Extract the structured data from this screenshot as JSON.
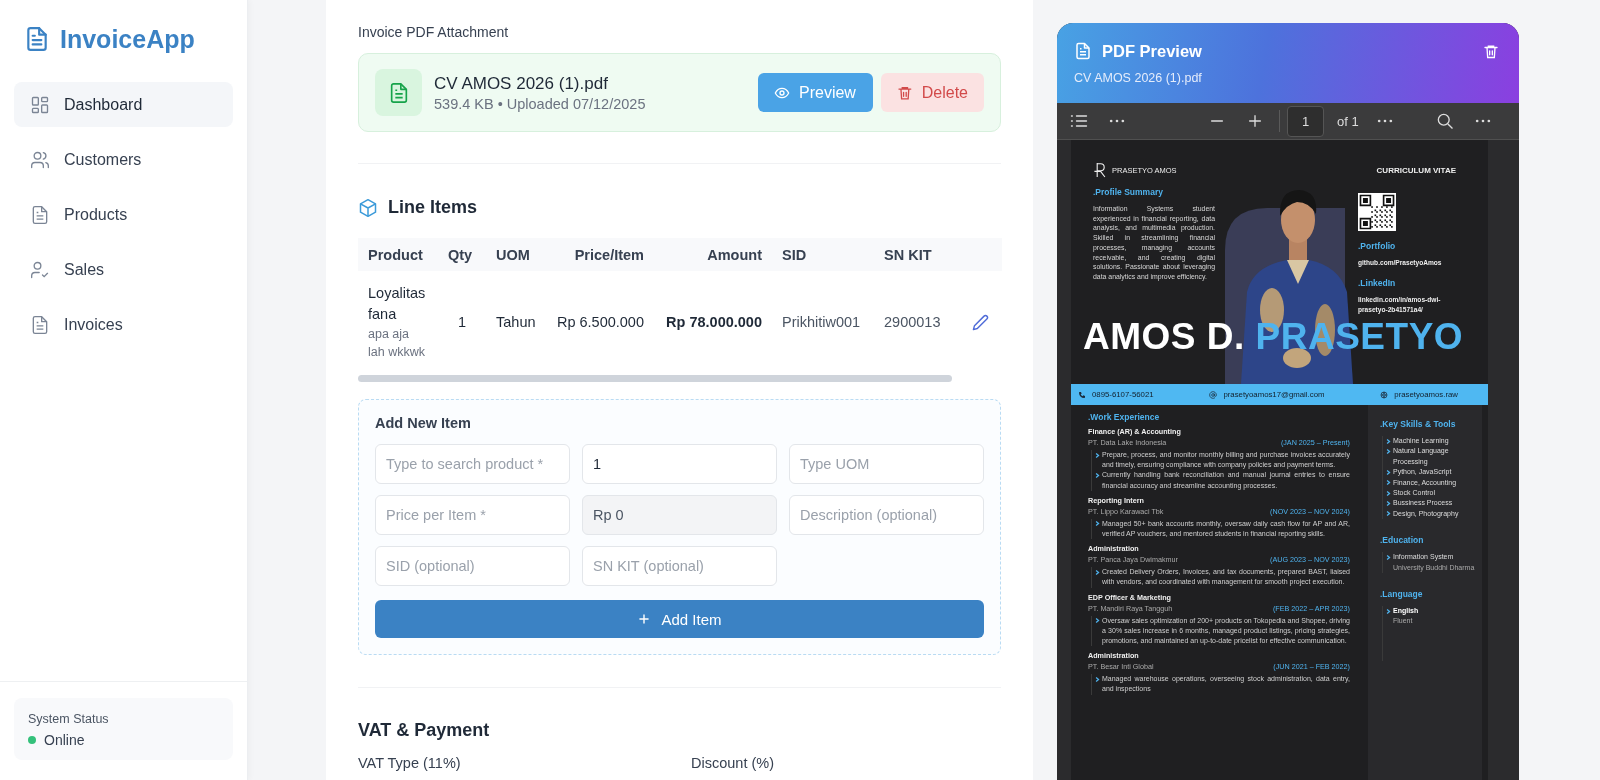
{
  "sidebar": {
    "logo": "InvoiceApp",
    "items": [
      {
        "label": "Dashboard",
        "selected": true
      },
      {
        "label": "Customers",
        "selected": false
      },
      {
        "label": "Products",
        "selected": false
      },
      {
        "label": "Sales",
        "selected": false
      },
      {
        "label": "Invoices",
        "selected": false
      }
    ],
    "system_status": {
      "label": "System Status",
      "status": "Online",
      "online": true
    }
  },
  "attachment": {
    "label": "Invoice PDF Attachment",
    "file_name": "CV AMOS 2026 (1).pdf",
    "meta": "539.4 KB • Uploaded 07/12/2025",
    "buttons": [
      {
        "label": "Preview",
        "kind": "preview"
      },
      {
        "label": "Delete",
        "kind": "delete"
      }
    ]
  },
  "line_items": {
    "title": "Line Items",
    "columns": [
      "Product",
      "Qty",
      "UOM",
      "Price/Item",
      "Amount",
      "SID",
      "SN KIT"
    ],
    "rows": [
      {
        "product": "Loyalitas fana",
        "description": "apa aja lah wkkwk",
        "qty": "1",
        "uom": "Tahun",
        "price": "Rp 6.500.000",
        "amount": "Rp 78.000.000",
        "sid": "Prikhitiw001",
        "sn_kit": "2900013"
      }
    ]
  },
  "add_item": {
    "title": "Add New Item",
    "fields": [
      {
        "placeholder": "Type to search product *",
        "disabled": false
      },
      {
        "value": "1",
        "disabled": false
      },
      {
        "placeholder": "Type UOM",
        "disabled": false
      },
      {
        "placeholder": "Price per Item *",
        "disabled": false
      },
      {
        "value": "Rp 0",
        "disabled": true
      },
      {
        "placeholder": "Description (optional)",
        "disabled": false
      },
      {
        "placeholder": "SID (optional)",
        "disabled": false
      },
      {
        "placeholder": "SN KIT (optional)",
        "disabled": false
      }
    ],
    "button": "Add Item"
  },
  "vat_payment": {
    "title": "VAT & Payment",
    "labels": [
      "VAT Type (11%)",
      "Discount (%)"
    ]
  },
  "pdf_preview": {
    "title": "PDF Preview",
    "file_name": "CV AMOS 2026 (1).pdf",
    "toolbar": {
      "page": "1",
      "page_count": "of 1"
    },
    "document": {
      "brand": "PRASETYO AMOS",
      "heading": "CURRICULUM VITAE",
      "profile": {
        "title": ".Profile Summary",
        "text": "Information Systems student experienced in financial reporting, data analysis, and multimedia production. Skilled in streamlining financial processes, managing accounts receivable, and creating digital solutions. Passionate about leveraging data analytics and improve efficiency."
      },
      "links": [
        {
          "title": ".Portfolio",
          "text": "github.com/PrasetyoAmos"
        },
        {
          "title": ".LinkedIn",
          "text": "linkedin.com/in/amos-dwi-prasetyo-2b41571a4/"
        }
      ],
      "name_first": "AMOS D.",
      "name_last": "PRASETYO",
      "contacts": [
        {
          "kind": "phone",
          "text": "0895-6107-56021"
        },
        {
          "kind": "email",
          "text": "prasetyoamos17@gmail.com"
        },
        {
          "kind": "web",
          "text": "prasetyoamos.raw"
        }
      ],
      "experience_title": ".Work Experience",
      "jobs": [
        {
          "role": "Finance (AR) & Accounting",
          "company": "PT. Data Lake Indonesia",
          "period": "(JAN 2025 – Present)",
          "points": [
            "Prepare, process, and monitor monthly billing and purchase invoices accurately and timely, ensuring compliance with company policies and payment terms.",
            "Currently handling bank reconciliation and manual journal entries to ensure financial accuracy and streamline accounting processes."
          ]
        },
        {
          "role": "Reporting Intern",
          "company": "PT. Lippo Karawaci Tbk",
          "period": "(NOV 2023 – NOV 2024)",
          "points": [
            "Managed 50+ bank accounts monthly, oversaw daily cash flow for AP and AR, verified AP vouchers, and mentored students in financial reporting skills."
          ]
        },
        {
          "role": "Administration",
          "company": "PT. Panca Jaya Dwimakmur",
          "period": "(AUG 2023 – NOV 2023)",
          "points": [
            "Created Delivery Orders, Invoices, and tax documents, prepared BAST, liaised with vendors, and coordinated with management for smooth project execution."
          ]
        },
        {
          "role": "EDP Officer & Marketing",
          "company": "PT. Mandiri Raya Tangguh",
          "period": "(FEB 2022 – APR 2023)",
          "points": [
            "Oversaw sales optimization of 200+ products on Tokopedia and Shopee, driving a 30% sales increase in 6 months, managed product listings, pricing strategies, promotions, and maintained an up-to-date pricelist for effective communication."
          ]
        },
        {
          "role": "Administration",
          "company": "PT. Besar Inti Global",
          "period": "(JUN 2021 – FEB 2022)",
          "points": [
            "Managed warehouse operations, overseeing stock administration, data entry, and inspections"
          ]
        }
      ],
      "skills": {
        "title": ".Key Skills & Tools",
        "items": [
          "Machine Learning",
          "Natural Language Processing",
          "Python, JavaScript",
          "Finance, Accounting",
          "Stock Control",
          "Bussiness Process",
          "Design, Photography"
        ]
      },
      "education": {
        "title": ".Education",
        "items": [
          {
            "name": "Information System",
            "detail": "University Buddhi Dharma"
          }
        ]
      },
      "language": {
        "title": ".Language",
        "items": [
          {
            "name": "English",
            "detail": "Fluent"
          }
        ]
      }
    }
  }
}
